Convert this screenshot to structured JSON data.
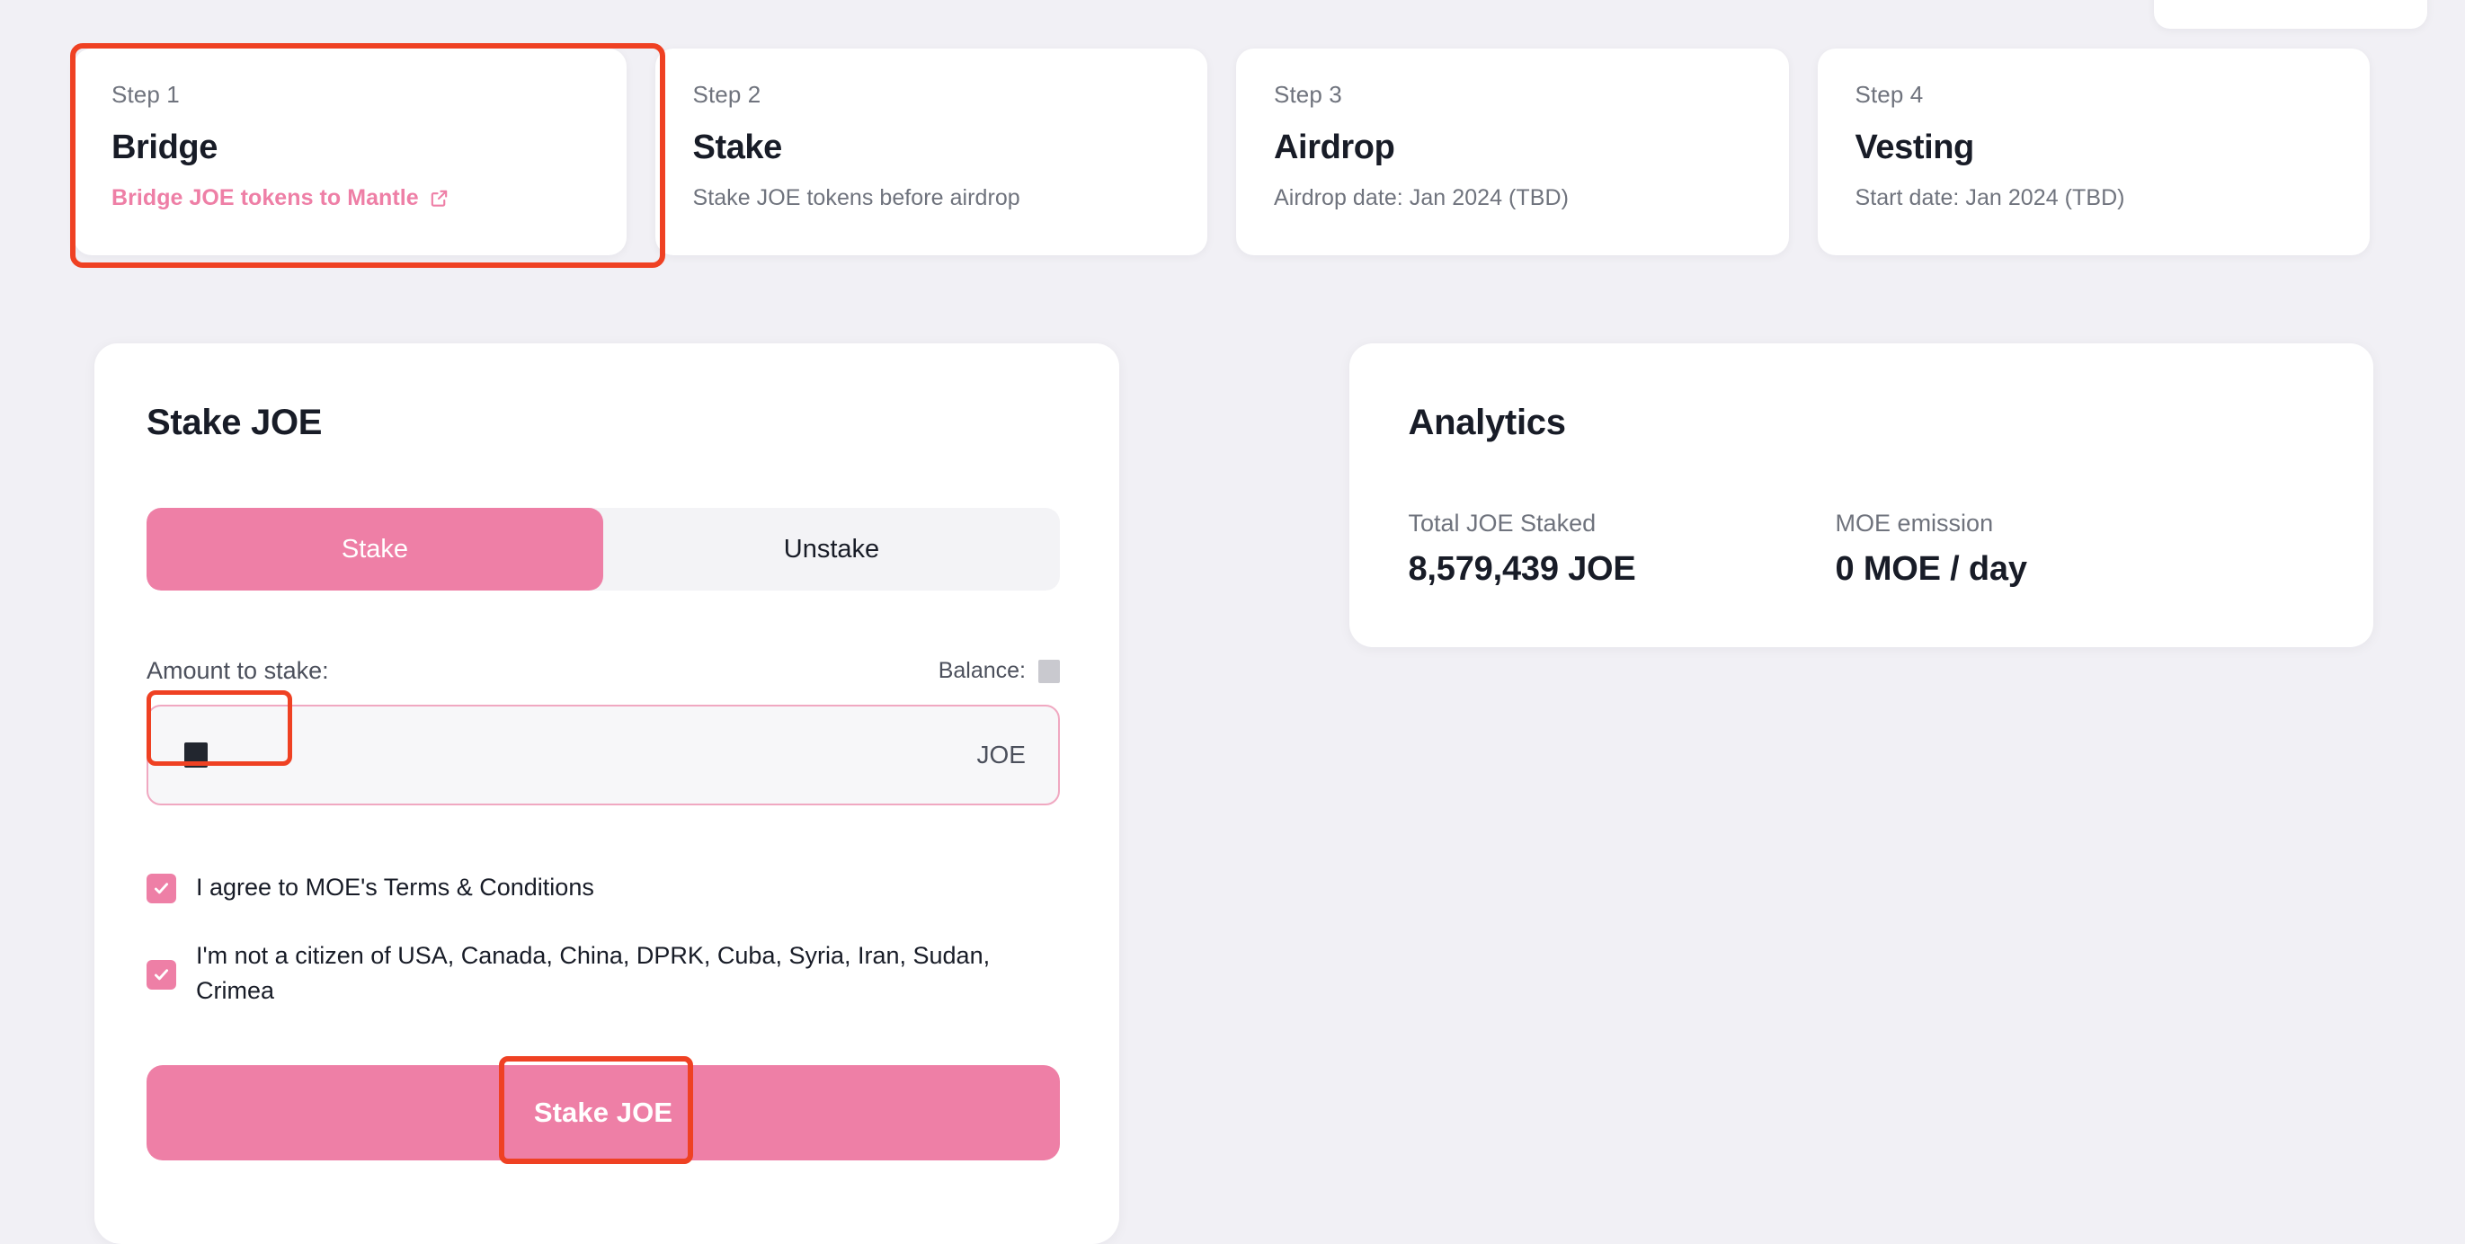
{
  "steps": [
    {
      "eyebrow": "Step 1",
      "title": "Bridge",
      "desc": "Bridge JOE tokens to Mantle",
      "is_link": true,
      "icon": "external-link-icon"
    },
    {
      "eyebrow": "Step 2",
      "title": "Stake",
      "desc": "Stake JOE tokens before airdrop",
      "is_link": false
    },
    {
      "eyebrow": "Step 3",
      "title": "Airdrop",
      "desc": "Airdrop date: Jan 2024 (TBD)",
      "is_link": false
    },
    {
      "eyebrow": "Step 4",
      "title": "Vesting",
      "desc": "Start date: Jan 2024 (TBD)",
      "is_link": false
    }
  ],
  "stake_panel": {
    "title": "Stake JOE",
    "tabs": [
      {
        "label": "Stake",
        "active": true
      },
      {
        "label": "Unstake",
        "active": false
      }
    ],
    "amount_label": "Amount to stake:",
    "balance_label": "Balance:",
    "balance_value": "",
    "input_value": "",
    "input_placeholder": "",
    "input_suffix": "JOE",
    "checkboxes": [
      {
        "label": "I agree to MOE's Terms & Conditions",
        "checked": true
      },
      {
        "label": "I'm not a citizen of USA, Canada, China, DPRK, Cuba, Syria, Iran, Sudan, Crimea",
        "checked": true
      }
    ],
    "submit_label": "Stake JOE"
  },
  "analytics": {
    "title": "Analytics",
    "metrics": [
      {
        "label": "Total JOE Staked",
        "value": "8,579,439 JOE"
      },
      {
        "label": "MOE emission",
        "value": "0 MOE / day"
      }
    ]
  },
  "colors": {
    "accent_pink": "#ee7fa6",
    "annotation_red": "#ef4123",
    "page_background": "#f1f0f5",
    "card_background": "#ffffff",
    "text_dark": "#181c27",
    "text_muted": "#6f737d"
  }
}
